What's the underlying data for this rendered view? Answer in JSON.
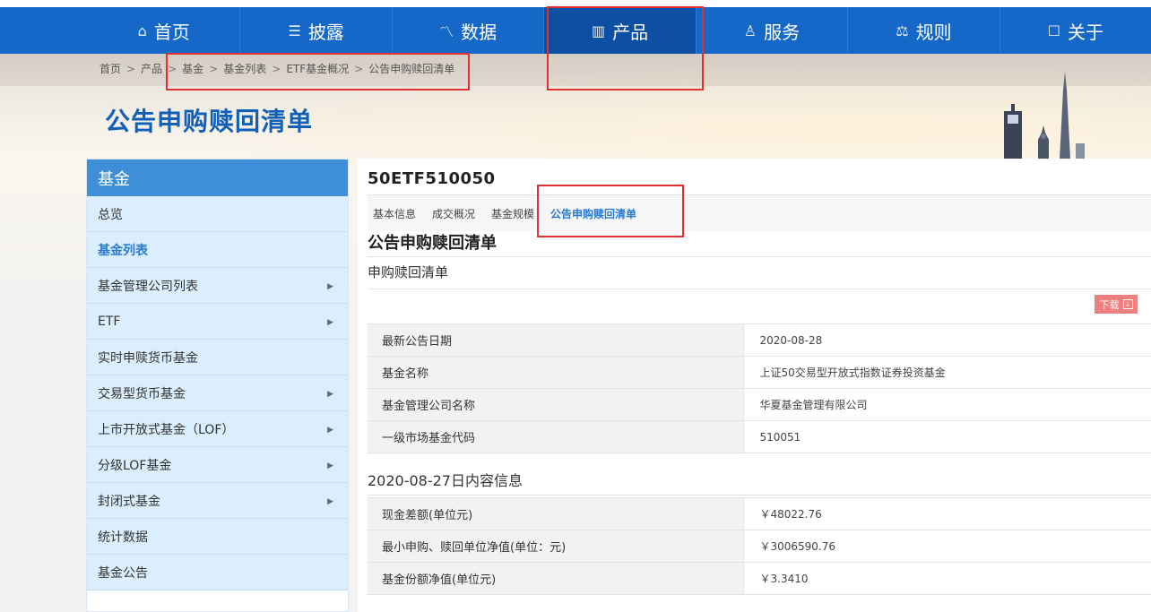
{
  "nav": {
    "items": [
      {
        "label": "首页",
        "icon": "home-icon"
      },
      {
        "label": "披露",
        "icon": "document-icon"
      },
      {
        "label": "数据",
        "icon": "trend-icon"
      },
      {
        "label": "产品",
        "icon": "chart-icon"
      },
      {
        "label": "服务",
        "icon": "user-icon"
      },
      {
        "label": "规则",
        "icon": "scale-icon"
      },
      {
        "label": "关于",
        "icon": "info-icon"
      }
    ],
    "active": "产品"
  },
  "breadcrumb": [
    "首页",
    "产品",
    "基金",
    "基金列表",
    "ETF基金概况",
    "公告申购赎回清单"
  ],
  "page_title": "公告申购赎回清单",
  "sidebar": {
    "heading": "基金",
    "items": [
      {
        "label": "总览"
      },
      {
        "label": "基金列表"
      },
      {
        "label": "基金管理公司列表"
      },
      {
        "label": "ETF"
      },
      {
        "label": "实时申赎货币基金"
      },
      {
        "label": "交易型货币基金"
      },
      {
        "label": "上市开放式基金（LOF）"
      },
      {
        "label": "分级LOF基金"
      },
      {
        "label": "封闭式基金"
      },
      {
        "label": "统计数据"
      },
      {
        "label": "基金公告"
      }
    ],
    "active": "基金列表"
  },
  "main": {
    "fund_title": "50ETF510050",
    "tabs": [
      "基本信息",
      "成交概况",
      "基金规模",
      "公告申购赎回清单"
    ],
    "active_tab": "公告申购赎回清单",
    "section_title": "公告申购赎回清单",
    "sub_title": "申购赎回清单",
    "download_label": "下载",
    "info_rows": [
      {
        "key": "最新公告日期",
        "value": "2020-08-28"
      },
      {
        "key": "基金名称",
        "value": "上证50交易型开放式指数证券投资基金"
      },
      {
        "key": "基金管理公司名称",
        "value": "华夏基金管理有限公司"
      },
      {
        "key": "一级市场基金代码",
        "value": "510051"
      }
    ],
    "section2_title": "2020-08-27日内容信息",
    "content_rows": [
      {
        "key": "现金差额(单位元)",
        "value": "￥48022.76"
      },
      {
        "key": "最小申购、赎回单位净值(单位：元)",
        "value": "￥3006590.76"
      },
      {
        "key": "基金份额净值(单位元)",
        "value": "￥3.3410"
      }
    ]
  },
  "colors": {
    "nav_bg": "#1668c8",
    "nav_active": "#0d4fa3",
    "title_blue": "#1160b8",
    "sidebar_head": "#3f8fd8",
    "sidebar_item_bg": "#dbeefd",
    "annotation_red": "#e03131",
    "download_bg": "#ef7e7e"
  }
}
